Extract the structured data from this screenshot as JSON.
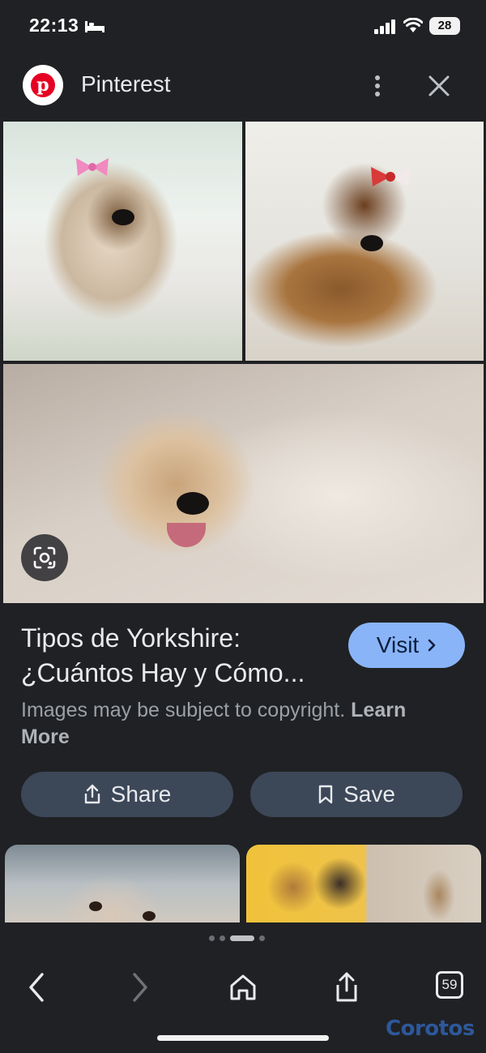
{
  "status_bar": {
    "time": "22:13",
    "battery": "28"
  },
  "header": {
    "site_name": "Pinterest"
  },
  "result": {
    "title_line1": "Tipos de Yorkshire:",
    "title_line2": "¿Cuántos Hay y Cómo...",
    "visit_label": "Visit",
    "copyright_text": "Images may be subject to copyright.",
    "learn_more": "Learn More",
    "share_label": "Share",
    "save_label": "Save"
  },
  "toolbar": {
    "tab_count": "59"
  },
  "watermark": "Corotos",
  "colors": {
    "background": "#202124",
    "visit_button": "#8ab4f8",
    "action_button": "#3c4758",
    "pinterest_red": "#e60023"
  },
  "icons": [
    "bed-icon",
    "signal-icon",
    "wifi-icon",
    "pinterest-logo",
    "more-vert-icon",
    "close-icon",
    "lens-icon",
    "chevron-right-icon",
    "share-icon",
    "bookmark-icon",
    "back-icon",
    "forward-icon",
    "home-icon",
    "share-nav-icon",
    "tabs-icon"
  ]
}
